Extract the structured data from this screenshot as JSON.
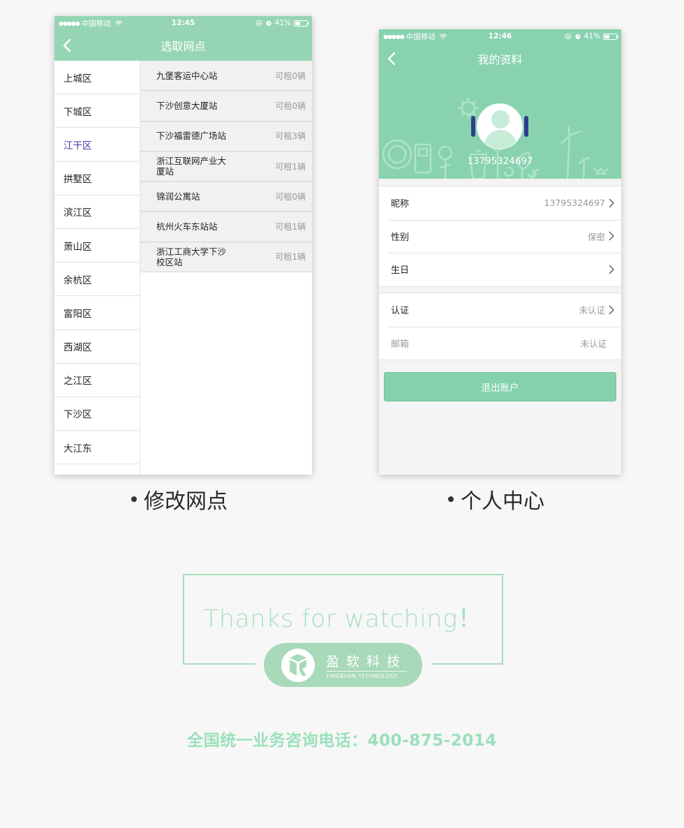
{
  "colors": {
    "accent": "#95d5b4",
    "accent_dark": "#84d1ac",
    "hotline": "#9be0bb",
    "active_district": "#3f3aa8"
  },
  "phone1": {
    "status": {
      "carrier": "中国移动",
      "time": "12:45",
      "battery": "41%",
      "battery_level": 0.41
    },
    "title": "选取网点",
    "districts": [
      {
        "label": "上城区",
        "active": false
      },
      {
        "label": "下城区",
        "active": false
      },
      {
        "label": "江干区",
        "active": true
      },
      {
        "label": "拱墅区",
        "active": false
      },
      {
        "label": "滨江区",
        "active": false
      },
      {
        "label": "萧山区",
        "active": false
      },
      {
        "label": "余杭区",
        "active": false
      },
      {
        "label": "富阳区",
        "active": false
      },
      {
        "label": "西湖区",
        "active": false
      },
      {
        "label": "之江区",
        "active": false
      },
      {
        "label": "下沙区",
        "active": false
      },
      {
        "label": "大江东",
        "active": false
      }
    ],
    "stations": [
      {
        "name": "九堡客运中心站",
        "availability": "可租0辆"
      },
      {
        "name": "下沙创意大厦站",
        "availability": "可租0辆"
      },
      {
        "name": "下沙福雷德广场站",
        "availability": "可租3辆"
      },
      {
        "name": "浙江互联网产业大厦站",
        "availability": "可租1辆"
      },
      {
        "name": "锦润公寓站",
        "availability": "可租0辆"
      },
      {
        "name": "杭州火车东站站",
        "availability": "可租1辆"
      },
      {
        "name": "浙江工商大学下沙校区站",
        "availability": "可租1辆"
      }
    ]
  },
  "phone2": {
    "status": {
      "carrier": "中国移动",
      "time": "12:46",
      "battery": "41%",
      "battery_level": 0.41
    },
    "title": "我的资料",
    "phone_number": "13795324697",
    "group1": [
      {
        "label": "昵称",
        "value": "13795324697"
      },
      {
        "label": "性别",
        "value": "保密"
      },
      {
        "label": "生日",
        "value": ""
      }
    ],
    "group2": [
      {
        "label": "认证",
        "value": "未认证"
      },
      {
        "label": "邮箱",
        "value": "未认证"
      }
    ],
    "logout": "退出账户"
  },
  "captions": {
    "left": "修改网点",
    "right": "个人中心"
  },
  "thanks": "Thanks for watching！",
  "brand": {
    "name": "盈软科技",
    "subtitle": "YINGRUAN TECHNOLOGY"
  },
  "hotline": "全国统一业务咨询电话：400-875-2014"
}
